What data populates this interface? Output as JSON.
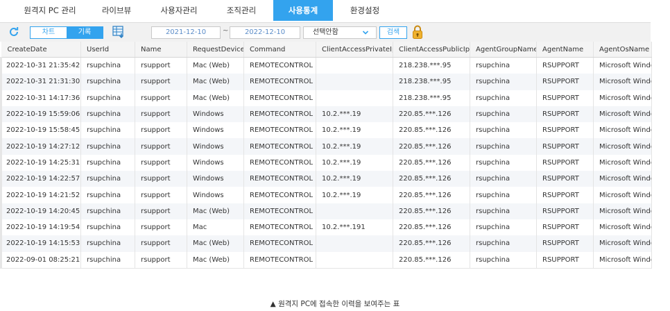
{
  "nav": {
    "tabs": [
      {
        "label": "원격지 PC 관리"
      },
      {
        "label": "라이브뷰"
      },
      {
        "label": "사용자관리"
      },
      {
        "label": "조직관리"
      },
      {
        "label": "사용통계",
        "active": true
      },
      {
        "label": "환경설정"
      }
    ]
  },
  "toolbar": {
    "chart_label": "차트",
    "history_label": "기록",
    "date_from": "2021-12-10",
    "date_sep": "~",
    "date_to": "2022-12-10",
    "select_value": "선택안함",
    "search_label": "검색"
  },
  "table": {
    "headers": [
      "CreateDate",
      "UserId",
      "Name",
      "RequestDevice",
      "Command",
      "ClientAccessPrivateIp",
      "ClientAccessPublicIp",
      "AgentGroupName",
      "AgentName",
      "AgentOsName"
    ],
    "rows": [
      [
        "2022-10-31 21:35:42",
        "rsupchina",
        "rsupport",
        "Mac (Web)",
        "REMOTECONTROL",
        "",
        "218.238.***.95",
        "rsupchina",
        "RSUPPORT",
        "Microsoft Windo"
      ],
      [
        "2022-10-31 21:31:30",
        "rsupchina",
        "rsupport",
        "Mac (Web)",
        "REMOTECONTROL",
        "",
        "218.238.***.95",
        "rsupchina",
        "RSUPPORT",
        "Microsoft Windo"
      ],
      [
        "2022-10-31 14:17:36",
        "rsupchina",
        "rsupport",
        "Mac (Web)",
        "REMOTECONTROL",
        "",
        "218.238.***.95",
        "rsupchina",
        "RSUPPORT",
        "Microsoft Windo"
      ],
      [
        "2022-10-19 15:59:06",
        "rsupchina",
        "rsupport",
        "Windows",
        "REMOTECONTROL",
        "10.2.***.19",
        "220.85.***.126",
        "rsupchina",
        "RSUPPORT",
        "Microsoft Windo"
      ],
      [
        "2022-10-19 15:58:45",
        "rsupchina",
        "rsupport",
        "Windows",
        "REMOTECONTROL",
        "10.2.***.19",
        "220.85.***.126",
        "rsupchina",
        "RSUPPORT",
        "Microsoft Windo"
      ],
      [
        "2022-10-19 14:27:12",
        "rsupchina",
        "rsupport",
        "Windows",
        "REMOTECONTROL",
        "10.2.***.19",
        "220.85.***.126",
        "rsupchina",
        "RSUPPORT",
        "Microsoft Windo"
      ],
      [
        "2022-10-19 14:25:31",
        "rsupchina",
        "rsupport",
        "Windows",
        "REMOTECONTROL",
        "10.2.***.19",
        "220.85.***.126",
        "rsupchina",
        "RSUPPORT",
        "Microsoft Windo"
      ],
      [
        "2022-10-19 14:22:57",
        "rsupchina",
        "rsupport",
        "Windows",
        "REMOTECONTROL",
        "10.2.***.19",
        "220.85.***.126",
        "rsupchina",
        "RSUPPORT",
        "Microsoft Windo"
      ],
      [
        "2022-10-19 14:21:52",
        "rsupchina",
        "rsupport",
        "Windows",
        "REMOTECONTROL",
        "10.2.***.19",
        "220.85.***.126",
        "rsupchina",
        "RSUPPORT",
        "Microsoft Windo"
      ],
      [
        "2022-10-19 14:20:45",
        "rsupchina",
        "rsupport",
        "Mac (Web)",
        "REMOTECONTROL",
        "",
        "220.85.***.126",
        "rsupchina",
        "RSUPPORT",
        "Microsoft Windo"
      ],
      [
        "2022-10-19 14:19:54",
        "rsupchina",
        "rsupport",
        "Mac",
        "REMOTECONTROL",
        "10.2.***.191",
        "220.85.***.126",
        "rsupchina",
        "RSUPPORT",
        "Microsoft Windo"
      ],
      [
        "2022-10-19 14:15:53",
        "rsupchina",
        "rsupport",
        "Mac (Web)",
        "REMOTECONTROL",
        "",
        "220.85.***.126",
        "rsupchina",
        "RSUPPORT",
        "Microsoft Windo"
      ],
      [
        "2022-09-01 08:25:21",
        "rsupchina",
        "rsupport",
        "Mac (Web)",
        "REMOTECONTROL",
        "",
        "220.85.***.126",
        "rsupchina",
        "RSUPPORT",
        "Microsoft Windo"
      ]
    ]
  },
  "caption": "▲ 원격지 PC에 접속한 이력을 보여주는 표",
  "colors": {
    "accent": "#33a3ee",
    "lock": "#e8a21c"
  },
  "icons": {
    "refresh": "refresh-icon",
    "export": "export-icon",
    "lock": "lock-icon",
    "dropdown": "chevron-down-icon"
  }
}
